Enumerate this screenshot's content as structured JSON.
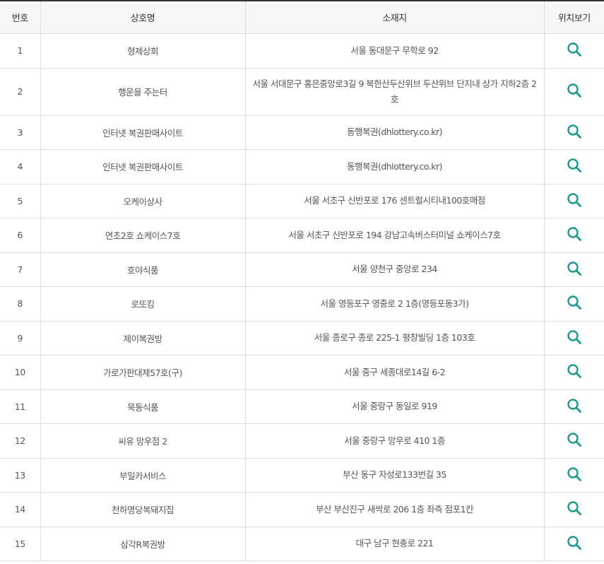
{
  "table": {
    "headers": {
      "no": "번호",
      "name": "상호명",
      "address": "소재지",
      "map": "위치보기"
    },
    "rows": [
      {
        "no": "1",
        "name": "형제상회",
        "address": "서울 동대문구 무학로 92"
      },
      {
        "no": "2",
        "name": "행운을 주는터",
        "address": "서울 서대문구 홍은중앙로3길 9 북한산두산위브 두산위브 단지내 상가 지하2층 2호"
      },
      {
        "no": "3",
        "name": "인터넷 복권판매사이트",
        "address": "동행복권(dhlottery.co.kr)"
      },
      {
        "no": "4",
        "name": "인터넷 복권판매사이트",
        "address": "동행복권(dhlottery.co.kr)"
      },
      {
        "no": "5",
        "name": "오케이상사",
        "address": "서울 서초구 신반포로 176 센트럴시티내100호매점"
      },
      {
        "no": "6",
        "name": "연초2호 쇼케이스7호",
        "address": "서울 서초구 신반포로 194 강남고속버스터미널 쇼케이스7호"
      },
      {
        "no": "7",
        "name": "호야식품",
        "address": "서울 양천구 중앙로 234"
      },
      {
        "no": "8",
        "name": "로또킹",
        "address": "서울 영등포구 영중로 2 1층(영등포동3가)"
      },
      {
        "no": "9",
        "name": "제이복권방",
        "address": "서울 종로구 종로 225-1 평창빌딩 1층 103호"
      },
      {
        "no": "10",
        "name": "가로가판대제57호(구)",
        "address": "서울 중구 세종대로14길 6-2"
      },
      {
        "no": "11",
        "name": "묵동식품",
        "address": "서울 중랑구 동일로 919"
      },
      {
        "no": "12",
        "name": "씨유 망우점 2",
        "address": "서울 중랑구 망우로 410 1층"
      },
      {
        "no": "13",
        "name": "부일카서비스",
        "address": "부산 동구 자성로133번길 35"
      },
      {
        "no": "14",
        "name": "천하명당복돼지집",
        "address": "부산 부산진구 새싹로 206 1층 좌측 점포1칸"
      },
      {
        "no": "15",
        "name": "삼각R복권방",
        "address": "대구 남구 현충로 221"
      }
    ],
    "map_icon": "search-icon",
    "accent_color": "#1a9b8a"
  }
}
